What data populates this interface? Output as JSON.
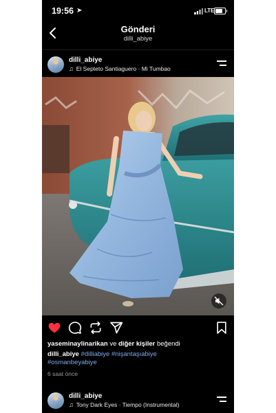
{
  "status_bar": {
    "time": "19:56",
    "network": "LTE"
  },
  "nav": {
    "title": "Gönderi",
    "subtitle": "dilli_abiye"
  },
  "post": {
    "username": "dilli_abiye",
    "song": "El Septeto Santiaguero · Mi Tumbao"
  },
  "engagement": {
    "liked_by_user": "yaseminaylinarikan",
    "liked_by_connector": "ve",
    "others_text": "diğer kişiler",
    "likes_suffix": "beğendi",
    "liked": true
  },
  "caption": {
    "username": "dilli_abiye",
    "hashtags_line1": "#dilliabiye #nişantaşıabiye",
    "hashtags_line2": "#osmanbeyabiye"
  },
  "posted_ago": "6 saat önce",
  "next_post": {
    "username": "dilli_abiye",
    "song": "Tony Dark Eyes · Tiempo (Instrumental)"
  },
  "colors": {
    "background": "#000000",
    "heart": "#ff3040",
    "hashtag": "#7fa9ef"
  },
  "icons": {
    "back": "chevron-left-icon",
    "menu": "menu-icon",
    "like": "heart-icon",
    "comment": "comment-icon",
    "share": "repost-icon",
    "send": "send-icon",
    "save": "bookmark-icon",
    "mute": "muted-speaker-icon",
    "music": "music-note-icon"
  }
}
